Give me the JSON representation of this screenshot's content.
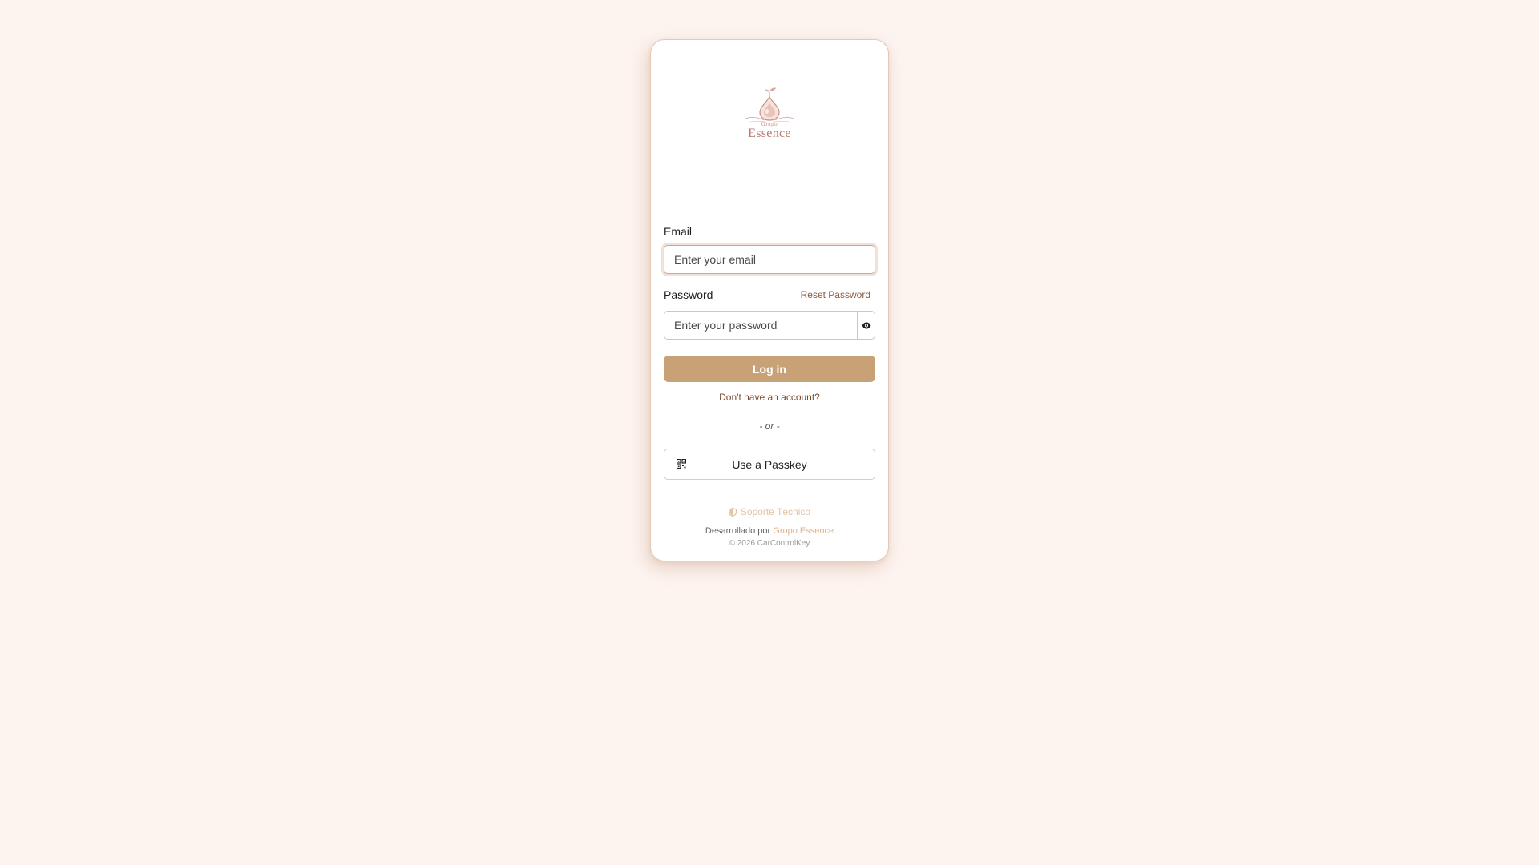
{
  "brand": {
    "logo_small": "Grupo",
    "logo_big": "Essence"
  },
  "form": {
    "email_label": "Email",
    "email_placeholder": "Enter your email",
    "password_label": "Password",
    "reset_password": "Reset Password",
    "password_placeholder": "Enter your password",
    "login_button": "Log in",
    "signup_link": "Don't have an account?",
    "or_separator": "- or -",
    "passkey_button": "Use a Passkey"
  },
  "footer": {
    "support": "Soporte Técnico",
    "developed_by": "Desarrollado por",
    "developer_name": "Grupo Essence",
    "copyright": "© 2026 CarControlKey"
  },
  "colors": {
    "background": "#fdf4f0",
    "accent": "#c9a177",
    "link": "#8a5a3c",
    "logo": "#b87a70"
  },
  "icons": {
    "password_toggle": "eye-icon",
    "passkey": "qr-code-icon",
    "support": "shield-icon"
  }
}
